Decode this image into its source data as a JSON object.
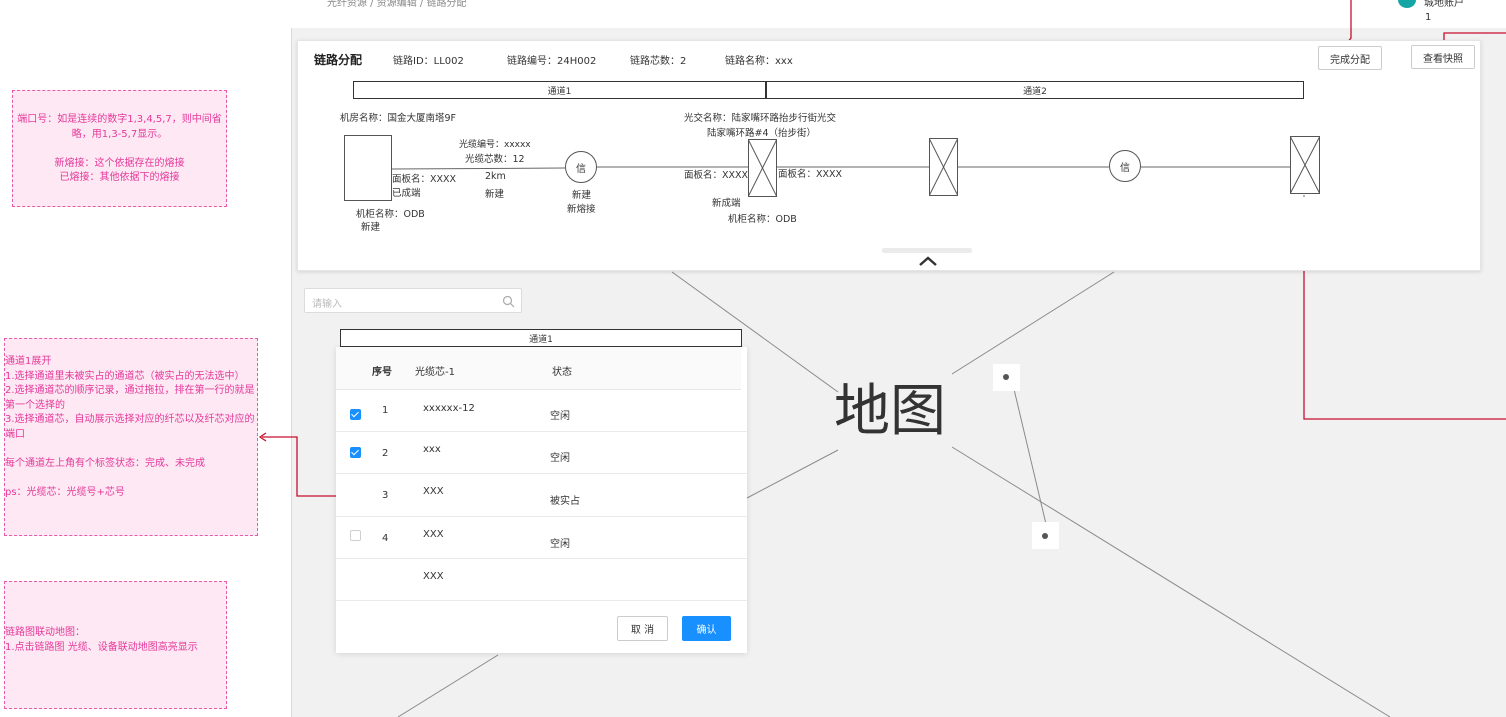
{
  "breadcrumb": "光纤资源 / 资源编辑 / 链路分配",
  "user": {
    "name": "城地账户",
    "line2": "1"
  },
  "notes": {
    "port": "端口号：如是连续的数字1,3,4,5,7，则中间省略，用1,3-5,7显示。\n\n新熔接：这个依据存在的熔接\n已熔接：其他依据下的熔接",
    "channel": "通道1展开\n1.选择通道里未被实占的通道芯（被实占的无法选中）\n2.选择通道芯的顺序记录，通过拖拉，排在第一行的就是第一个选择的\n3.选择通道芯，自动展示选择对应的纤芯以及纤芯对应的端口\n\n每个通道左上角有个标签状态：完成、未完成\n\nps：光缆芯：光缆号+芯号",
    "map": "链路图联动地图：\n1.点击链路图 光缆、设备联动地图高亮显示"
  },
  "header": {
    "title": "链路分配",
    "link_id": "链路ID：LL002",
    "link_no": "链路编号：24H002",
    "core_count": "链路芯数：2",
    "link_name": "链路名称：xxx",
    "complete_btn": "完成分配",
    "snapshot_btn": "查看快照"
  },
  "diagram": {
    "channel1": "通道1",
    "channel2": "通道2",
    "room_name": "机房名称：国金大厦南塔9F",
    "cable_no": "光缆编号：xxxxx",
    "cable_cores": "光缆芯数：12",
    "panel_left": "面板名：XXXX",
    "formed_left": "已成端",
    "length": "2km",
    "new_cable": "新建",
    "cabinet_left": "机柜名称：ODB",
    "cabinet_left_status": "新建",
    "splice_symbol": "信",
    "splice_new": "新建",
    "splice_new_fusion": "新熔接",
    "cross_name": "光交名称：陆家嘴环路抬步行街光交",
    "cross_name2": "陆家嘴环路#4（抬步街）",
    "panel_mid_left": "面板名：XXXX",
    "panel_mid_right": "面板名：XXXX",
    "formed_mid": "新成端",
    "cabinet_mid": "机柜名称：ODB"
  },
  "map_label": "地图",
  "search": {
    "placeholder": "请输入"
  },
  "channel_panel": {
    "channel_label": "通道1",
    "columns": [
      "序号",
      "光缆芯-1",
      "状态"
    ],
    "rows": [
      {
        "no": "1",
        "core": "xxxxxx-12",
        "status": "空闲",
        "check": "on"
      },
      {
        "no": "2",
        "core": "xxx",
        "status": "空闲",
        "check": "on"
      },
      {
        "no": "3",
        "core": "XXX",
        "status": "被实占",
        "check": "none"
      },
      {
        "no": "4",
        "core": "XXX",
        "status": "空闲",
        "check": "off"
      },
      {
        "no": "",
        "core": "XXX",
        "status": "",
        "check": "none"
      }
    ],
    "cancel": "取 消",
    "confirm": "确认"
  }
}
